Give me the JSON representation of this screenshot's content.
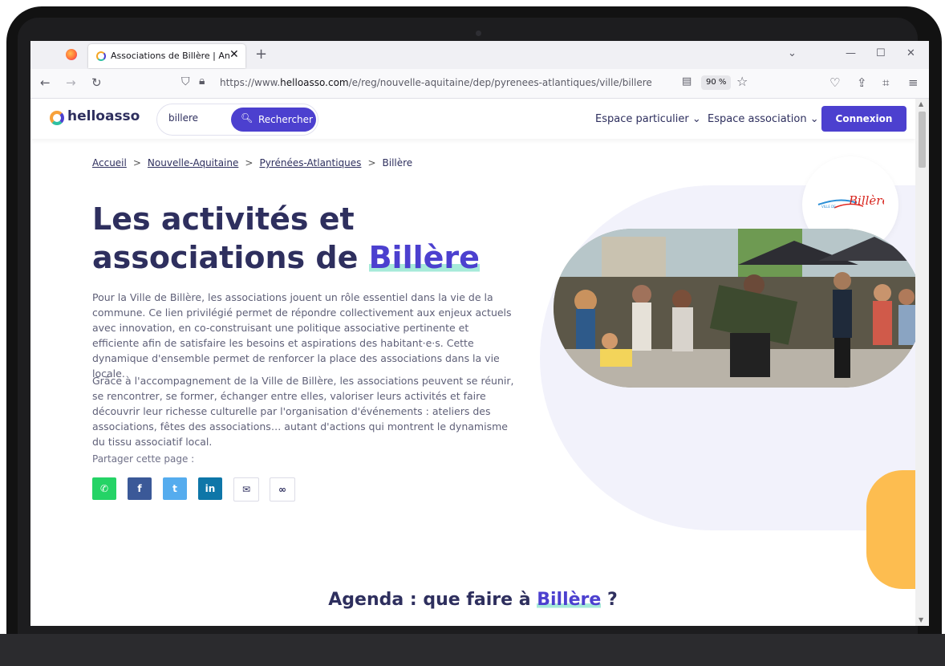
{
  "browser": {
    "tab_title": "Associations de Billère | Annuaire",
    "tab_close": "✕",
    "new_tab": "+",
    "url_prefix": "https://www.",
    "url_domain": "helloasso.com",
    "url_path": "/e/reg/nouvelle-aquitaine/dep/pyrenees-atlantiques/ville/billere",
    "zoom": "90 %"
  },
  "header": {
    "logo_text": "helloasso",
    "search_value": "billere",
    "search_button": "Rechercher",
    "menu_particulier": "Espace particulier",
    "menu_association": "Espace association",
    "connexion": "Connexion"
  },
  "breadcrumb": {
    "home": "Accueil",
    "region": "Nouvelle-Aquitaine",
    "department": "Pyrénées-Atlantiques",
    "city": "Billère"
  },
  "hero": {
    "title_line1": "Les activités et",
    "title_line2": "associations de",
    "title_highlight": "Billère",
    "paragraph1": "Pour la Ville de Billère, les associations jouent un rôle essentiel dans la vie de la commune. Ce lien privilégié permet de répondre collectivement aux enjeux actuels avec innovation, en co-construisant une politique associative pertinente et efficiente afin de satisfaire les besoins et aspirations des habitant·e·s. Cette dynamique d'ensemble permet de renforcer la place des associations dans la vie locale.",
    "paragraph2": "Grâce à l'accompagnement de la Ville de Billère, les associations peuvent se réunir, se rencontrer, se former, échanger entre elles, valoriser leurs activités et faire découvrir leur richesse culturelle par l'organisation d'événements : ateliers des associations, fêtes des associations… autant d'actions qui montrent le dynamisme du tissu associatif local.",
    "share_label": "Partager cette page :",
    "city_logo_text": "Billère",
    "city_logo_small": "VILLE DE"
  },
  "share_buttons": [
    {
      "name": "whatsapp",
      "glyph": "✆",
      "color": "#25d366"
    },
    {
      "name": "facebook",
      "glyph": "f",
      "color": "#3b5998"
    },
    {
      "name": "twitter",
      "glyph": "t",
      "color": "#55acee"
    },
    {
      "name": "linkedin",
      "glyph": "in",
      "color": "#0e76a8"
    },
    {
      "name": "email",
      "glyph": "✉",
      "color": "#ffffff"
    },
    {
      "name": "copy-link",
      "glyph": "∞",
      "color": "#ffffff"
    }
  ],
  "agenda": {
    "prefix": "Agenda : que faire à",
    "highlight": "Billère",
    "suffix": "?"
  },
  "colors": {
    "primary": "#4c40cf",
    "navy": "#2e2f5e",
    "highlight": "#a6ead9",
    "blob": "#f2f2fb",
    "orange": "#fdbd50"
  }
}
